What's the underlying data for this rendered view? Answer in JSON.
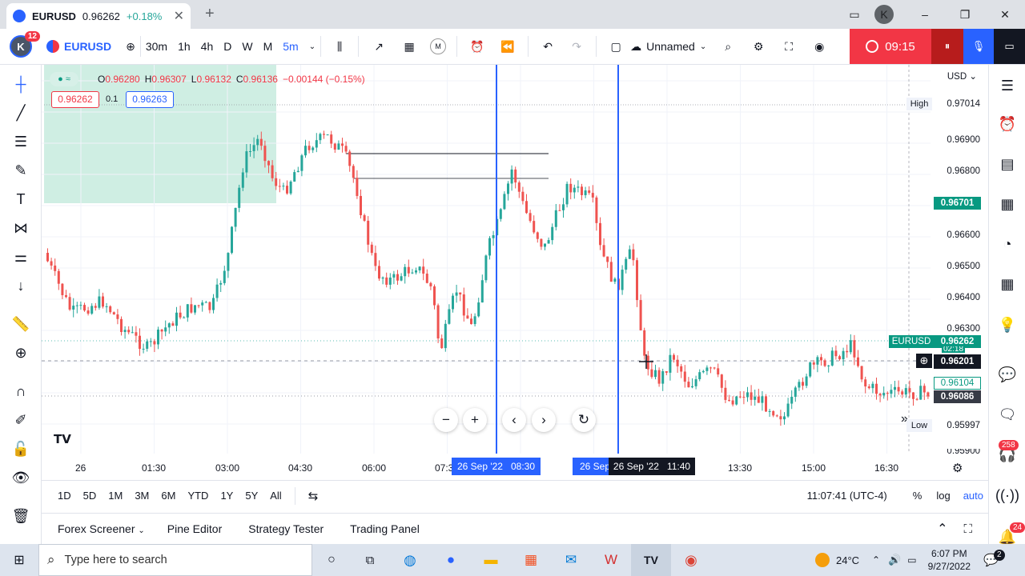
{
  "browser": {
    "tab_symbol": "EURUSD",
    "tab_price": "0.96262",
    "tab_change": "+0.18%",
    "profile_initial": "K",
    "min_label": "–",
    "max_label": "❐",
    "close_label": "✕"
  },
  "toolbar": {
    "avatar_initial": "K",
    "notification_count": "12",
    "symbol": "EURUSD",
    "intervals": [
      "30m",
      "1h",
      "4h",
      "D",
      "W",
      "M",
      "5m"
    ],
    "layout_name": "Unnamed",
    "record_time": "09:15"
  },
  "legend": {
    "open_label": "O",
    "open": "0.96280",
    "high_label": "H",
    "high": "0.96307",
    "low_label": "L",
    "low": "0.96132",
    "close_label": "C",
    "close": "0.96136",
    "change": "−0.00144 (−0.15%)",
    "bid": "0.96262",
    "spread": "0.1",
    "ask": "0.96263"
  },
  "price_axis": {
    "currency": "USD",
    "labels": [
      "0.96900",
      "0.96800",
      "0.96600",
      "0.96500",
      "0.96400",
      "0.96300",
      "0.95900"
    ],
    "high_tag": "High",
    "high_value": "0.97014",
    "tag_green": "0.96701",
    "symbol_tag": "EURUSD",
    "last_price": "0.96262",
    "cursor_price": "0.96201",
    "tag_outline": "0.96104",
    "tag_dark": "0.96086",
    "low_tag": "Low",
    "low_value": "0.95997",
    "partial_label": "02:18"
  },
  "time_axis": {
    "labels": [
      "26",
      "01:30",
      "03:00",
      "04:30",
      "06:00",
      "07:3",
      "13:30",
      "15:00",
      "16:30"
    ],
    "marker1": "26 Sep '22   08:30",
    "marker2_partial": "26 Sep",
    "marker2": "26 Sep '22   11:40"
  },
  "bottom": {
    "ranges": [
      "1D",
      "5D",
      "1M",
      "3M",
      "6M",
      "YTD",
      "1Y",
      "5Y",
      "All"
    ],
    "clock": "11:07:41 (UTC-4)",
    "percent": "%",
    "log": "log",
    "auto": "auto"
  },
  "panels": [
    "Forex Screener",
    "Pine Editor",
    "Strategy Tester",
    "Trading Panel"
  ],
  "right_badges": {
    "chat": "258",
    "alerts": "24"
  },
  "taskbar": {
    "search_placeholder": "Type here to search",
    "temperature": "24°C",
    "time": "6:07 PM",
    "date": "9/27/2022",
    "notif_count": "2"
  },
  "colors": {
    "up": "#26a69a",
    "down": "#ef5350",
    "accent": "#2962ff",
    "record": "#f23645"
  }
}
